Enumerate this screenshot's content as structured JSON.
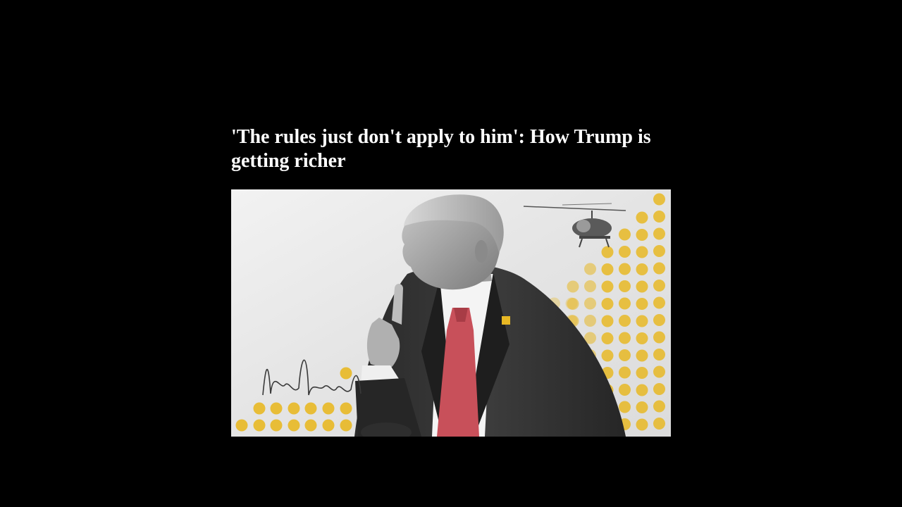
{
  "article": {
    "headline": "'The rules just don't apply to him': How Trump is getting richer",
    "image": {
      "kind": "editorial-collage",
      "accent_color": "#e8b824",
      "tie_color": "#d24a58",
      "background_color": "#e9e9e9"
    }
  }
}
